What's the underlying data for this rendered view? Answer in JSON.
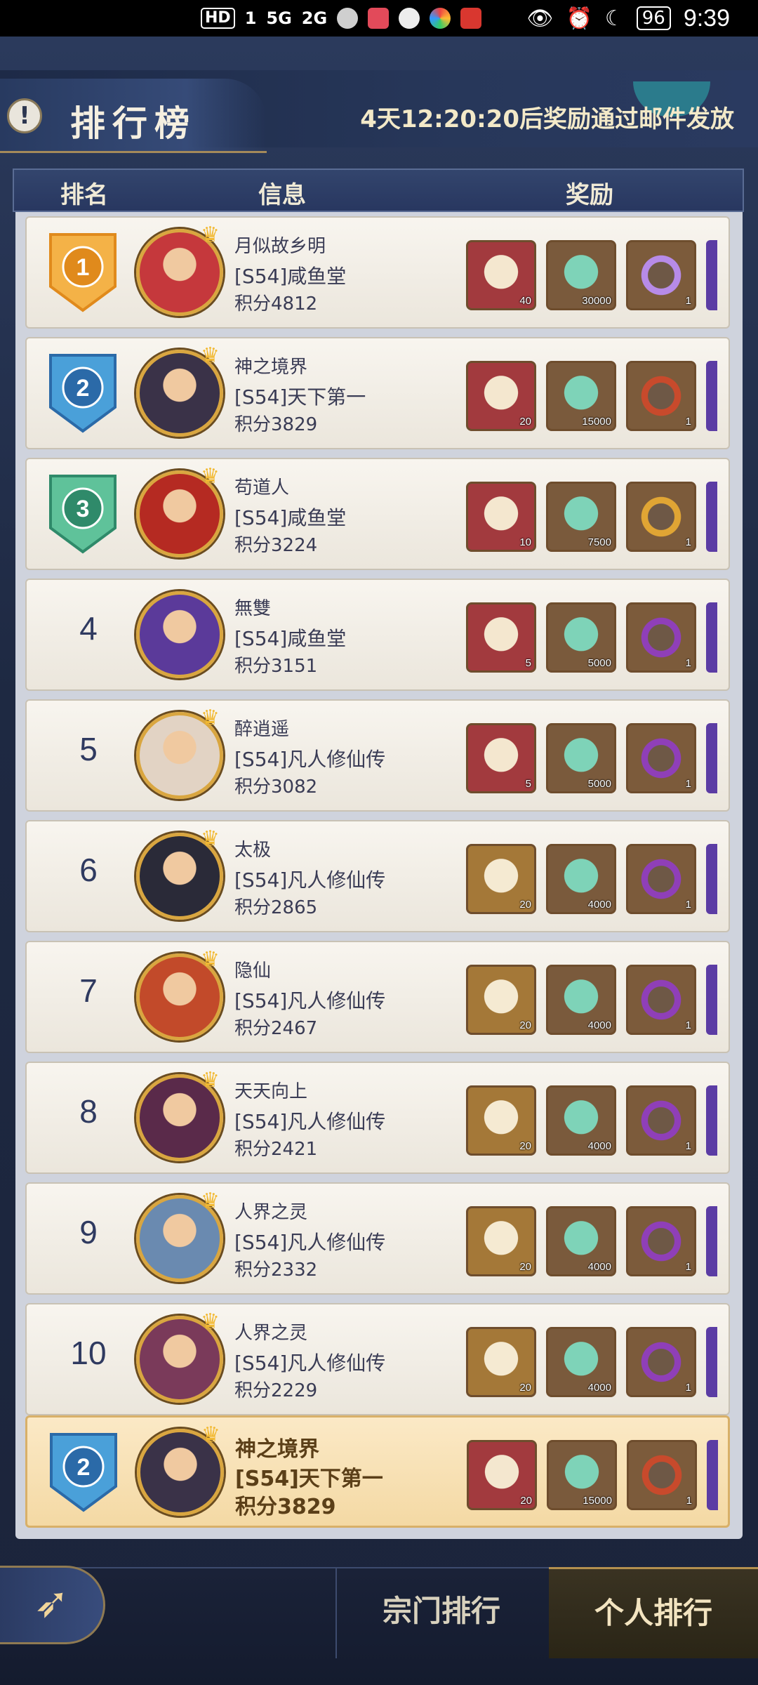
{
  "status_bar": {
    "left_items": [
      "HD",
      "1",
      "5G",
      "2G"
    ],
    "battery": "96",
    "time": "9:39"
  },
  "header": {
    "title": "排行榜",
    "countdown": "4天12:20:20后奖励通过邮件发放"
  },
  "columns": {
    "rank": "排名",
    "info": "信息",
    "reward": "奖励"
  },
  "rows": [
    {
      "rank": "1",
      "name": "月似故乡明",
      "guild": "[S54]咸鱼堂",
      "score": "积分4812",
      "rewards": [
        "40",
        "30000",
        "1"
      ]
    },
    {
      "rank": "2",
      "name": "神之境界",
      "guild": "[S54]天下第一",
      "score": "积分3829",
      "rewards": [
        "20",
        "15000",
        "1"
      ]
    },
    {
      "rank": "3",
      "name": "苟道人",
      "guild": "[S54]咸鱼堂",
      "score": "积分3224",
      "rewards": [
        "10",
        "7500",
        "1"
      ]
    },
    {
      "rank": "4",
      "name": "無雙",
      "guild": "[S54]咸鱼堂",
      "score": "积分3151",
      "rewards": [
        "5",
        "5000",
        "1"
      ]
    },
    {
      "rank": "5",
      "name": "醉逍遥",
      "guild": "[S54]凡人修仙传",
      "score": "积分3082",
      "rewards": [
        "5",
        "5000",
        "1"
      ]
    },
    {
      "rank": "6",
      "name": "太极",
      "guild": "[S54]凡人修仙传",
      "score": "积分2865",
      "rewards": [
        "20",
        "4000",
        "1"
      ]
    },
    {
      "rank": "7",
      "name": "隐仙",
      "guild": "[S54]凡人修仙传",
      "score": "积分2467",
      "rewards": [
        "20",
        "4000",
        "1"
      ]
    },
    {
      "rank": "8",
      "name": "天天向上",
      "guild": "[S54]凡人修仙传",
      "score": "积分2421",
      "rewards": [
        "20",
        "4000",
        "1"
      ]
    },
    {
      "rank": "9",
      "name": "人界之灵",
      "guild": "[S54]凡人修仙传",
      "score": "积分2332",
      "rewards": [
        "20",
        "4000",
        "1"
      ]
    },
    {
      "rank": "10",
      "name": "人界之灵",
      "guild": "[S54]凡人修仙传",
      "score": "积分2229",
      "rewards": [
        "20",
        "4000",
        "1"
      ]
    }
  ],
  "my_row": {
    "rank": "2",
    "name": "神之境界",
    "guild": "[S54]天下第一",
    "score": "积分3829",
    "rewards": [
      "20",
      "15000",
      "1"
    ]
  },
  "bottom_tabs": {
    "guild": "宗门排行",
    "personal": "个人排行"
  },
  "icons": {
    "alert": "exclamation-icon",
    "back": "crane-icon"
  }
}
